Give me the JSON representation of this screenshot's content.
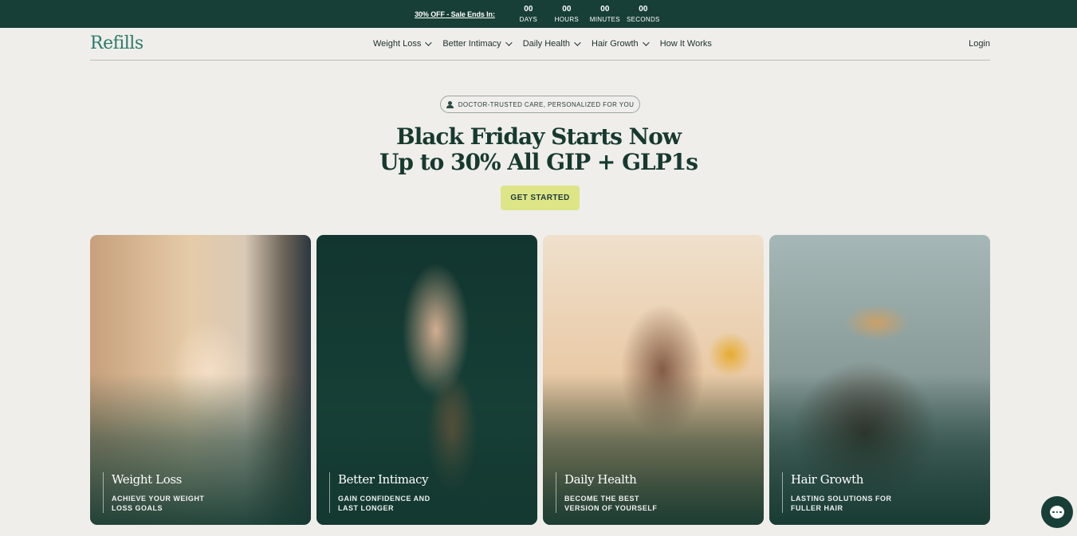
{
  "promo": {
    "text": "30% OFF - Sale Ends In:",
    "countdown": [
      {
        "value": "00",
        "label": "DAYS"
      },
      {
        "value": "00",
        "label": "HOURS"
      },
      {
        "value": "00",
        "label": "MINUTES"
      },
      {
        "value": "00",
        "label": "SECONDS"
      }
    ]
  },
  "nav": {
    "logo": "Refills",
    "items": [
      {
        "label": "Weight Loss"
      },
      {
        "label": "Better Intimacy"
      },
      {
        "label": "Daily Health"
      },
      {
        "label": "Hair Growth"
      },
      {
        "label": "How It Works"
      }
    ],
    "login": "Login"
  },
  "hero": {
    "badge": "DOCTOR-TRUSTED CARE, PERSONALIZED FOR YOU",
    "title_line1": "Black Friday Starts Now",
    "title_line2": "Up to 30% All GIP + GLP1s",
    "cta": "GET STARTED"
  },
  "cards": [
    {
      "title": "Weight Loss",
      "sub1": "ACHIEVE YOUR WEIGHT",
      "sub2": "LOSS GOALS"
    },
    {
      "title": "Better Intimacy",
      "sub1": "GAIN CONFIDENCE AND",
      "sub2": "LAST LONGER"
    },
    {
      "title": "Daily Health",
      "sub1": "BECOME THE BEST",
      "sub2": "VERSION OF YOURSELF"
    },
    {
      "title": "Hair Growth",
      "sub1": "LASTING SOLUTIONS FOR",
      "sub2": "FULLER HAIR"
    }
  ],
  "colors": {
    "brand_dark": "#173f37",
    "logo": "#2c7a6a",
    "cta": "#dde587",
    "background": "#efeeea"
  }
}
